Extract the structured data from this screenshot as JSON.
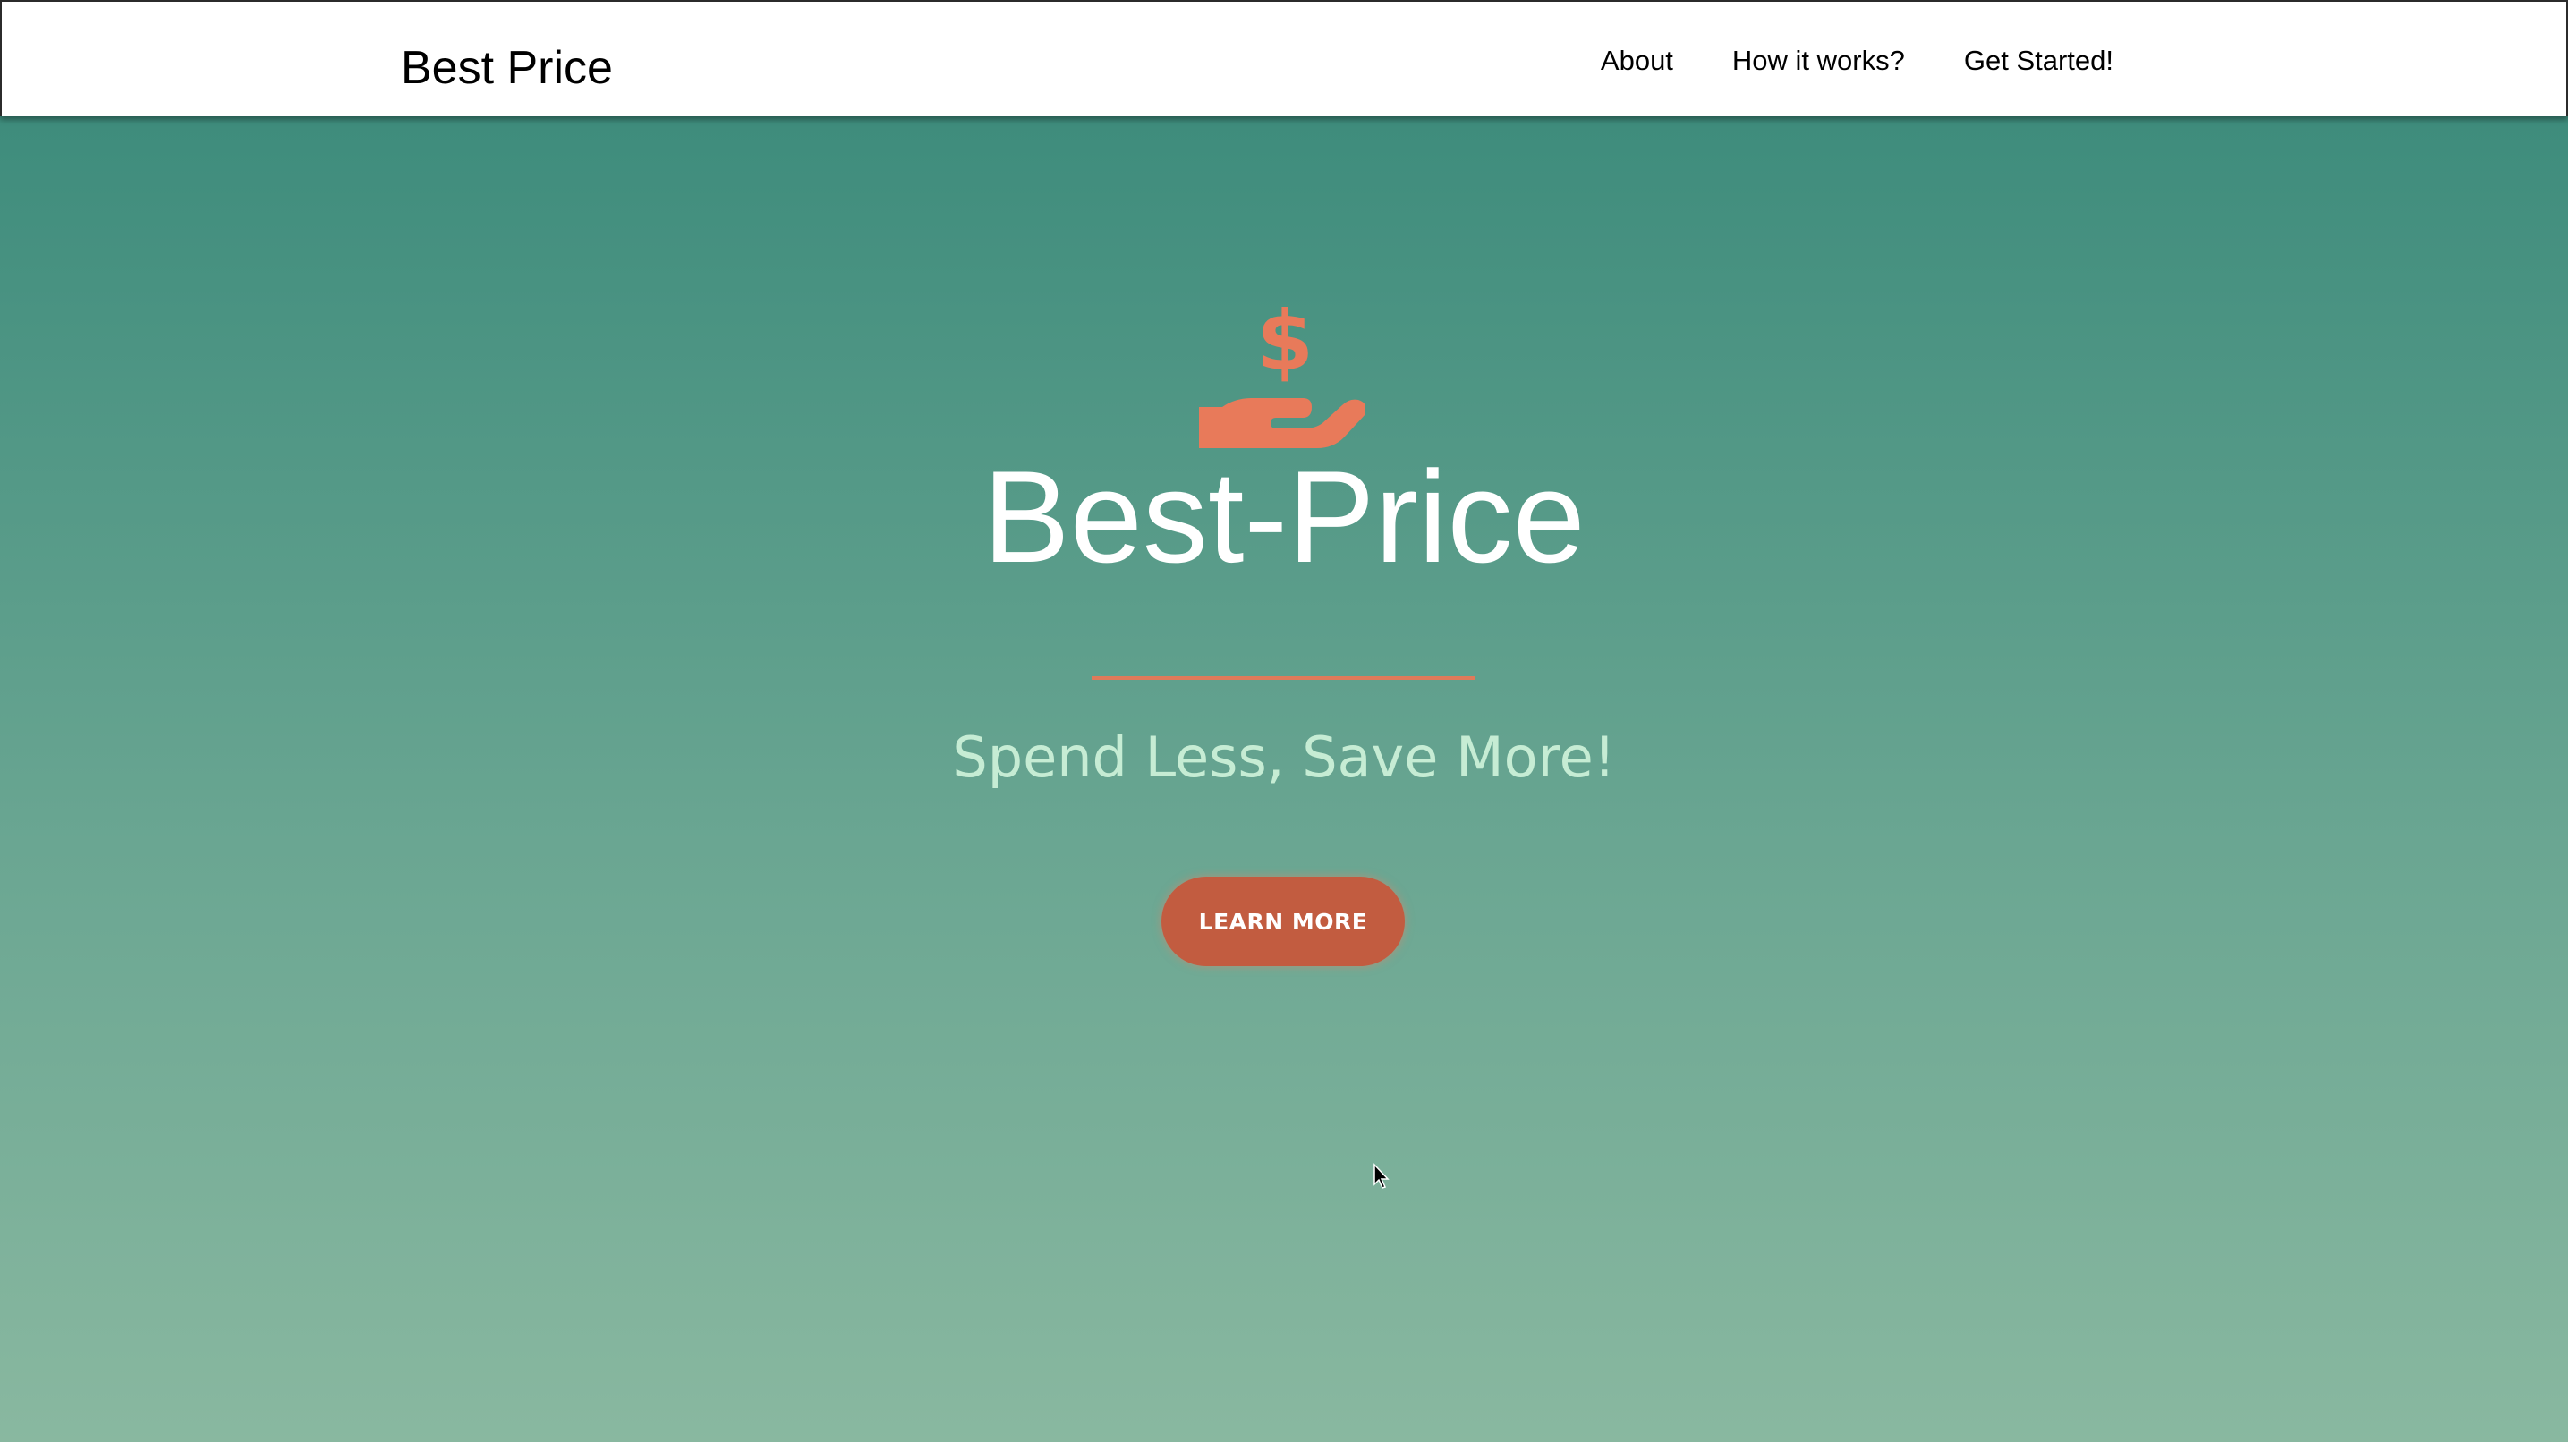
{
  "navbar": {
    "brand": "Best Price",
    "links": [
      {
        "label": "About"
      },
      {
        "label": "How it works?"
      },
      {
        "label": "Get Started!"
      }
    ]
  },
  "hero": {
    "icon": "hand-holding-dollar-icon",
    "title": "Best-Price",
    "tagline": "Spend Less, Save More!",
    "cta_label": "LEARN MORE"
  },
  "colors": {
    "accent": "#c25c40",
    "icon": "#e87a5a",
    "gradient_top": "#3e8c7c",
    "gradient_bottom": "#89b8a0",
    "tagline": "#c6ecd4"
  }
}
